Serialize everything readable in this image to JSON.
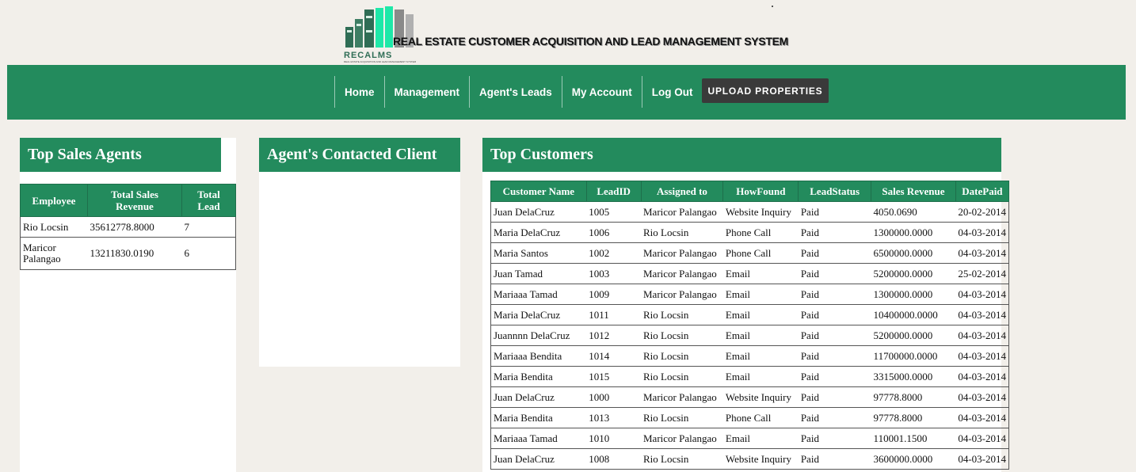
{
  "header": {
    "logo_text": "RECALMS",
    "logo_subtext": "REAL ESTATE ACQUISITION AND LEAD MANAGEMENT SYSTEM",
    "title": "REAL ESTATE CUSTOMER ACQUISITION AND LEAD MANAGEMENT SYSTEM"
  },
  "nav": {
    "items": [
      "Home",
      "Management",
      "Agent's Leads",
      "My Account",
      "Log Out"
    ],
    "upload_label": "UPLOAD PROPERTIES"
  },
  "top_sales_agents": {
    "title": "Top Sales Agents",
    "columns": [
      "Employee",
      "Total Sales Revenue",
      "Total Lead"
    ],
    "rows": [
      [
        "Rio Locsin",
        "35612778.8000",
        "7"
      ],
      [
        "Maricor Palangao",
        "13211830.0190",
        "6"
      ]
    ]
  },
  "agents_contacted": {
    "title": "Agent's Contacted Client"
  },
  "top_customers": {
    "title": "Top Customers",
    "columns": [
      "Customer Name",
      "LeadID",
      "Assigned to",
      "HowFound",
      "LeadStatus",
      "Sales Revenue",
      "DatePaid"
    ],
    "rows": [
      [
        "Juan DelaCruz",
        "1005",
        "Maricor Palangao",
        "Website Inquiry",
        "Paid",
        "4050.0690",
        "20-02-2014"
      ],
      [
        "Maria DelaCruz",
        "1006",
        "Rio Locsin",
        "Phone Call",
        "Paid",
        "1300000.0000",
        "04-03-2014"
      ],
      [
        "Maria Santos",
        "1002",
        "Maricor Palangao",
        "Phone Call",
        "Paid",
        "6500000.0000",
        "04-03-2014"
      ],
      [
        "Juan Tamad",
        "1003",
        "Maricor Palangao",
        "Email",
        "Paid",
        "5200000.0000",
        "25-02-2014"
      ],
      [
        "Mariaaa Tamad",
        "1009",
        "Maricor Palangao",
        "Email",
        "Paid",
        "1300000.0000",
        "04-03-2014"
      ],
      [
        "Maria DelaCruz",
        "1011",
        "Rio Locsin",
        "Email",
        "Paid",
        "10400000.0000",
        "04-03-2014"
      ],
      [
        "Juannnn DelaCruz",
        "1012",
        "Rio Locsin",
        "Email",
        "Paid",
        "5200000.0000",
        "04-03-2014"
      ],
      [
        "Mariaaa Bendita",
        "1014",
        "Rio Locsin",
        "Email",
        "Paid",
        "11700000.0000",
        "04-03-2014"
      ],
      [
        "Maria Bendita",
        "1015",
        "Rio Locsin",
        "Email",
        "Paid",
        "3315000.0000",
        "04-03-2014"
      ],
      [
        "Juan DelaCruz",
        "1000",
        "Maricor Palangao",
        "Website Inquiry",
        "Paid",
        "97778.8000",
        "04-03-2014"
      ],
      [
        "Maria Bendita",
        "1013",
        "Rio Locsin",
        "Phone Call",
        "Paid",
        "97778.8000",
        "04-03-2014"
      ],
      [
        "Mariaaa Tamad",
        "1010",
        "Maricor Palangao",
        "Email",
        "Paid",
        "110001.1500",
        "04-03-2014"
      ],
      [
        "Juan DelaCruz",
        "1008",
        "Rio Locsin",
        "Website Inquiry",
        "Paid",
        "3600000.0000",
        "04-03-2014"
      ]
    ]
  },
  "colors": {
    "brand_green": "#238b5d",
    "button_dark": "#3a3a3a",
    "page_bg": "#f2efea",
    "logo_accent": "#1ee8a8"
  }
}
